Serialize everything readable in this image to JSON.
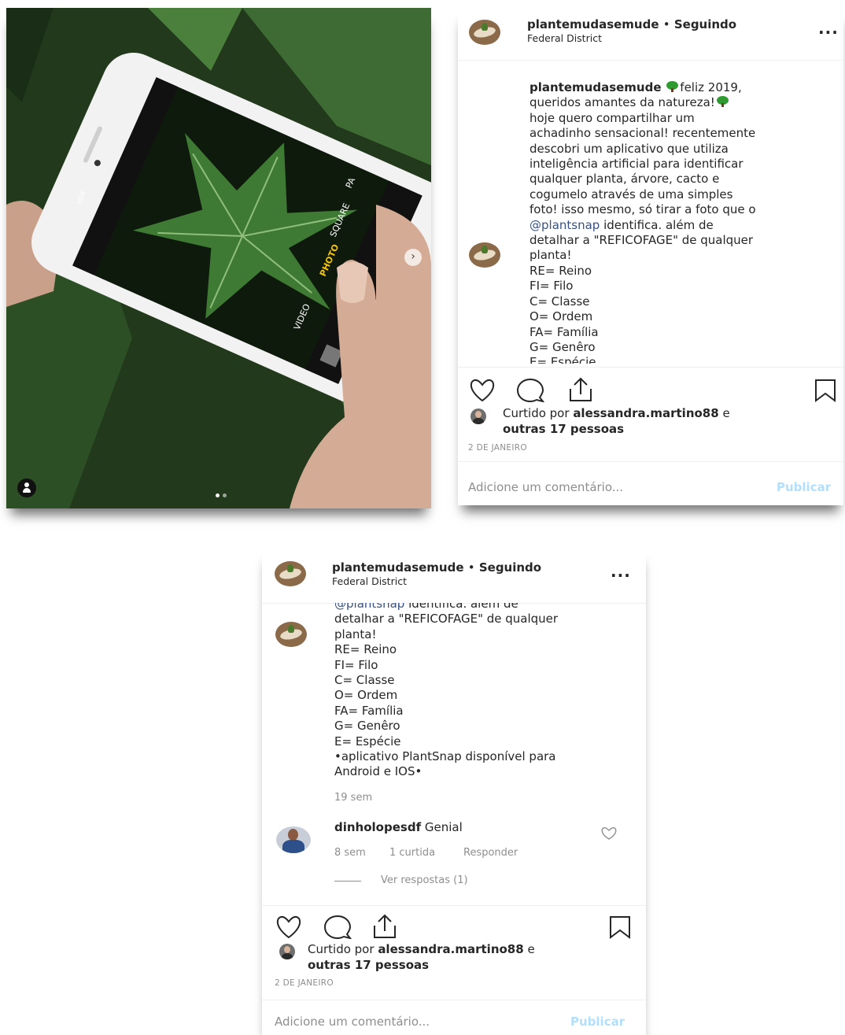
{
  "post": {
    "username": "plantemudasemude",
    "separator": "•",
    "follow_status": "Seguindo",
    "location": "Federal District",
    "more_label": "...",
    "caption_lines_full": [
      "feliz 2019,",
      "queridos amantes da natureza!",
      "hoje quero compartilhar um",
      "achadinho sensacional! recentemente",
      "descobri um aplicativo que utiliza",
      "inteligência artificial para identificar",
      "qualquer planta, árvore, cacto e",
      "cogumelo através de uma simples",
      "foto! isso mesmo, só tirar a foto que o"
    ],
    "mention": "@plantsnap",
    "mention_rest": "identifica. além de",
    "caption_tail": [
      "detalhar a \"REFICOFAGE\" de qualquer",
      "planta!",
      "RE= Reino",
      "FI= Filo",
      "C= Classe",
      "O= Ordem",
      "FA= Família",
      "G= Genêro",
      "E= Espécie",
      "•aplicativo PlantSnap disponível para",
      "Android e IOS•"
    ],
    "caption_age": "19 sem",
    "likes_prefix": "Curtido por",
    "liked_by": "alessandra.martino88",
    "likes_mid": "e",
    "likes_others": "outras 17 pessoas",
    "date": "2 DE JANEIRO",
    "comment_placeholder": "Adicione um comentário...",
    "publish_label": "Publicar"
  },
  "comment": {
    "username": "dinholopesdf",
    "text": "Genial",
    "age": "8 sem",
    "likes": "1 curtida",
    "reply": "Responder",
    "view_replies": "Ver respostas (1)"
  },
  "photo": {
    "camera_modes": [
      "VIDEO",
      "PHOTO",
      "SQUARE",
      "PA"
    ],
    "hdr": "HDR",
    "carousel_total": 2,
    "carousel_current": 1
  },
  "colors": {
    "mention": "#385185",
    "publish_disabled": "#b2dffc",
    "muted": "#8e8e8e",
    "text": "#262626",
    "leaf": "#3f7a34"
  },
  "icons": [
    "heart-icon",
    "comment-icon",
    "share-icon",
    "bookmark-icon",
    "user-tag-icon",
    "chevron-right-icon",
    "more-icon"
  ]
}
